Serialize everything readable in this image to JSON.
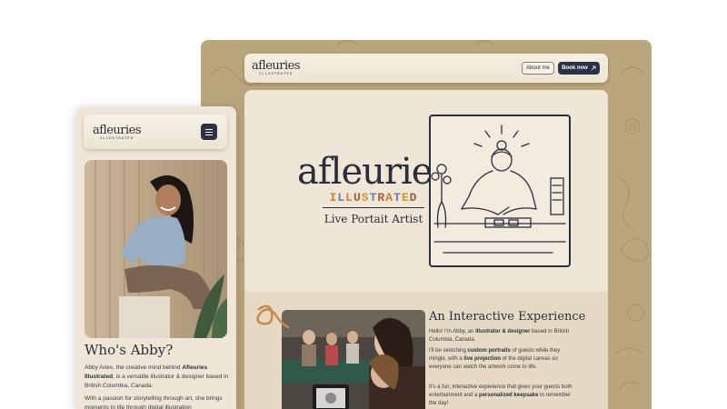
{
  "brand": {
    "logo_main": "afleuries",
    "logo_sub": "ILLUSTRATED",
    "hero_ill_letters": [
      "I",
      "L",
      "L",
      "U",
      "S",
      "T",
      "R",
      "A",
      "T",
      "E",
      "D"
    ],
    "tagline": "Live Portait Artist"
  },
  "desktop": {
    "nav": {
      "about_label": "About me",
      "book_label": "Book now",
      "book_icon": "arrow-up-right-icon"
    },
    "section": {
      "title": "An Interactive Experience",
      "p1_a": "Hello! I'm Abby, an ",
      "p1_b": "illustrator & designer",
      "p1_c": " based in British Columbia, Canada.",
      "p2_a": "I'll be sketching ",
      "p2_b": "custom portraits",
      "p2_c": " of guests while they mingle, with a ",
      "p2_d": "live projection",
      "p2_e": " of the digital canvas so everyone can watch the artwork come to life.",
      "p3_a": "It's a fun, interactive experience that gives your guests both entertainment and a ",
      "p3_b": "personalized keepsake",
      "p3_c": " to remember the day!"
    }
  },
  "mobile": {
    "menu_icon": "hamburger-menu-icon",
    "title": "Who's Abby?",
    "p1_a": "Abby Aries, the creative mind behind ",
    "p1_b": "Afleuries Illustrated",
    "p1_c": ", is a versatile illustrator & designer based in British Columbia, Canada.",
    "p2": "With a passion for storytelling through art, she brings moments to life through digital illustration"
  },
  "colors": {
    "navy": "#2b3246",
    "tan_background": "#b9a67c",
    "cream": "#efe6d8",
    "ill_letter_colors": [
      "#c9812d",
      "#6b7fa8",
      "#c9812d",
      "#a85a3c",
      "#c99a2d",
      "#6b7fa8",
      "#a85a3c",
      "#c9812d",
      "#6b7fa8",
      "#c99a2d",
      "#a85a3c"
    ]
  }
}
